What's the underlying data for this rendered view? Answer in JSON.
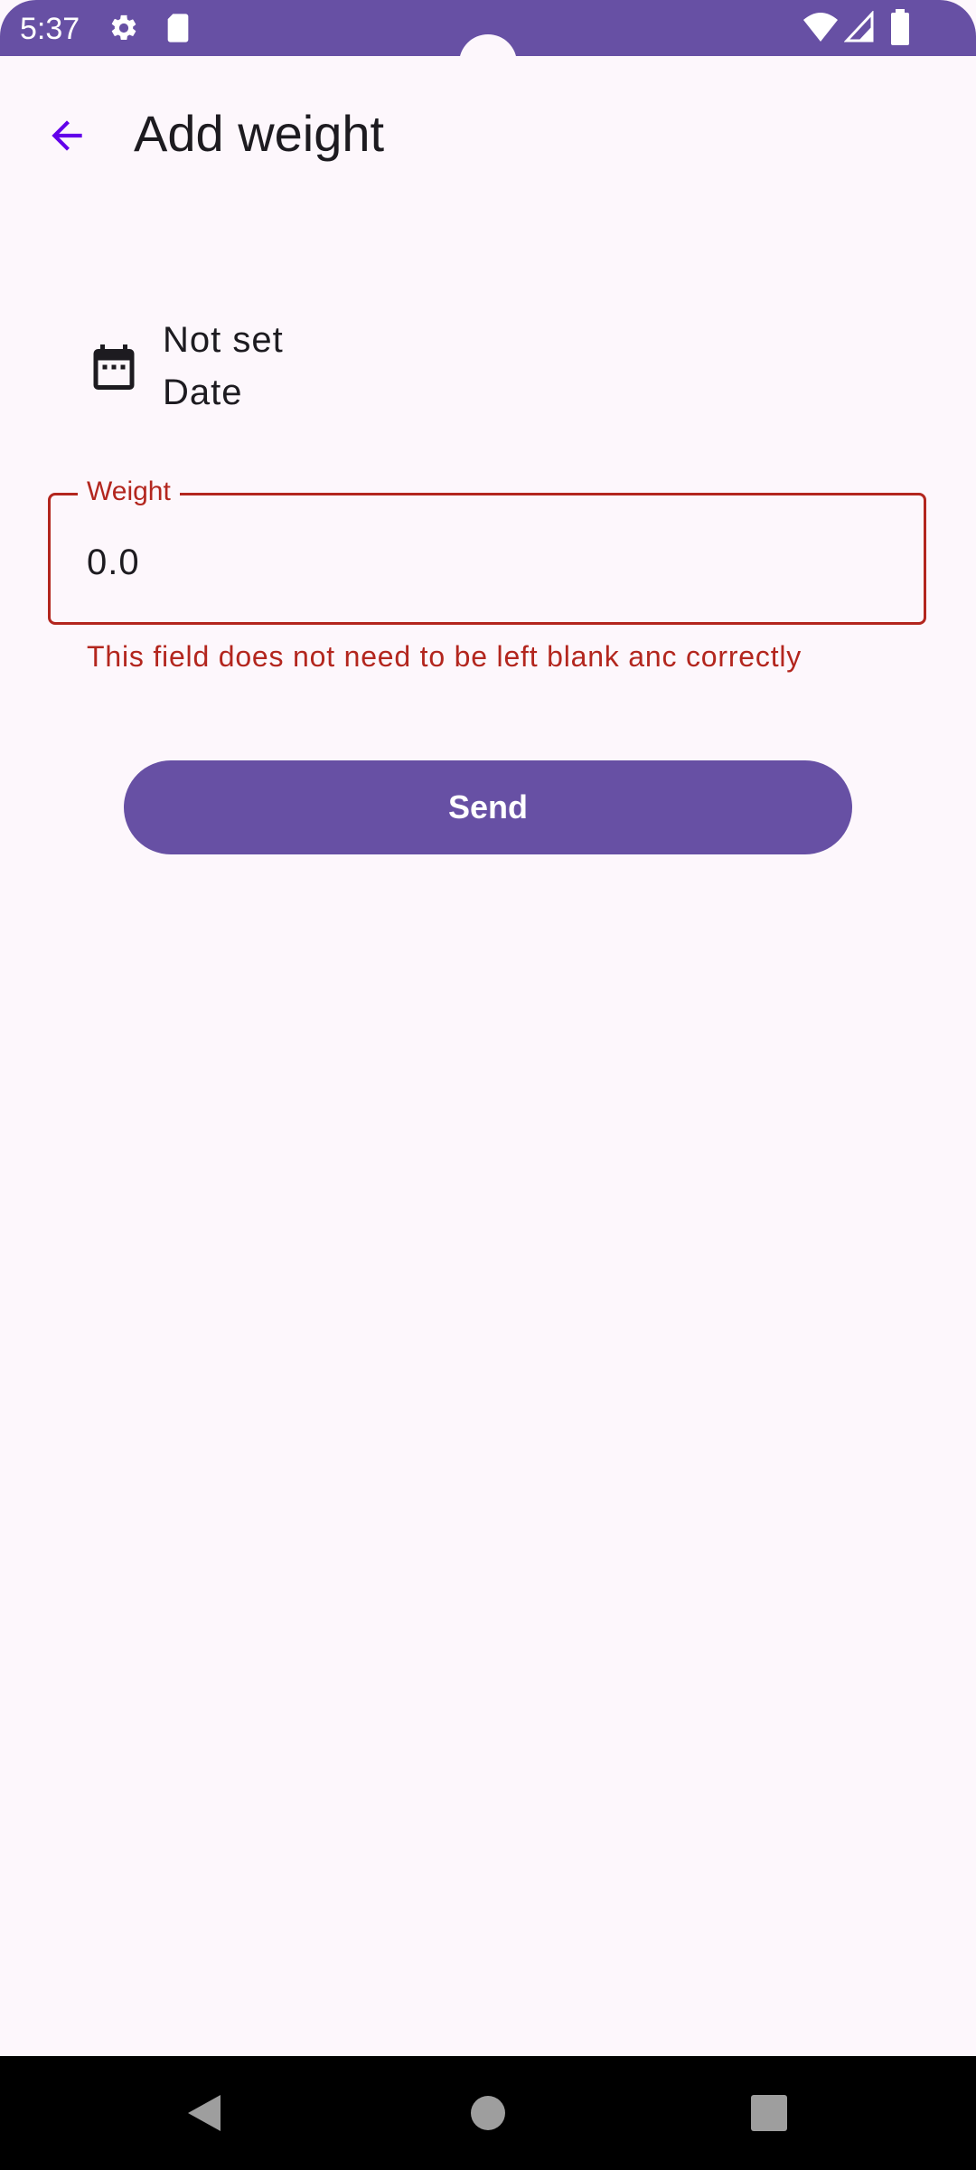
{
  "status_bar": {
    "time": "5:37",
    "left_icons": [
      "gear-icon",
      "sd-card-icon"
    ],
    "right_icons": [
      "wifi-icon",
      "cellular-signal-icon",
      "battery-icon"
    ],
    "background_color": "#6750a4"
  },
  "app_bar": {
    "title": "Add weight",
    "back_icon": "arrow-back-icon"
  },
  "date_picker": {
    "icon": "calendar-icon",
    "value": "Not set",
    "label": "Date"
  },
  "weight_field": {
    "label": "Weight",
    "value": "0.0",
    "error": "This field does not need to be left blank anc correctly",
    "error_color": "#b3261e"
  },
  "send_button": {
    "label": "Send",
    "color": "#6750a4"
  },
  "nav_bar": {
    "icons": [
      "back-triangle-icon",
      "home-circle-icon",
      "recents-square-icon"
    ]
  }
}
